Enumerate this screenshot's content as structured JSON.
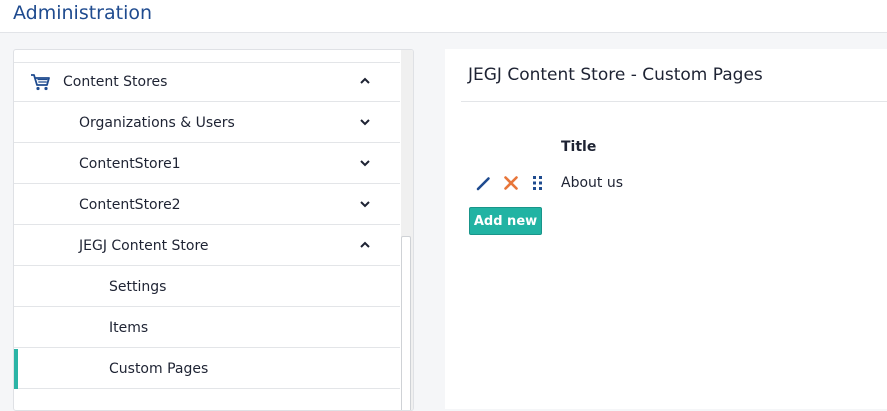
{
  "app": {
    "title": "Administration"
  },
  "sidebar": {
    "items": [
      {
        "label": "Content Stores",
        "icon": "cart-icon",
        "chevron": "up"
      },
      {
        "label": "Organizations & Users",
        "chevron": "down"
      },
      {
        "label": "ContentStore1",
        "chevron": "down"
      },
      {
        "label": "ContentStore2",
        "chevron": "down"
      },
      {
        "label": "JEGJ Content Store",
        "chevron": "up"
      },
      {
        "label": "Settings"
      },
      {
        "label": "Items"
      },
      {
        "label": "Custom Pages",
        "active": true
      }
    ]
  },
  "main": {
    "title": "JEGJ Content Store - Custom Pages",
    "table": {
      "columns": [
        "Title"
      ],
      "rows": [
        {
          "title": "About us",
          "actions": [
            "edit-icon",
            "delete-icon",
            "drag-handle-icon"
          ]
        }
      ]
    },
    "add_button": "Add new"
  },
  "colors": {
    "brand": "#1f4b8f",
    "accent": "#21b3a3",
    "delete": "#e8763a",
    "edit": "#1f4b8f"
  }
}
